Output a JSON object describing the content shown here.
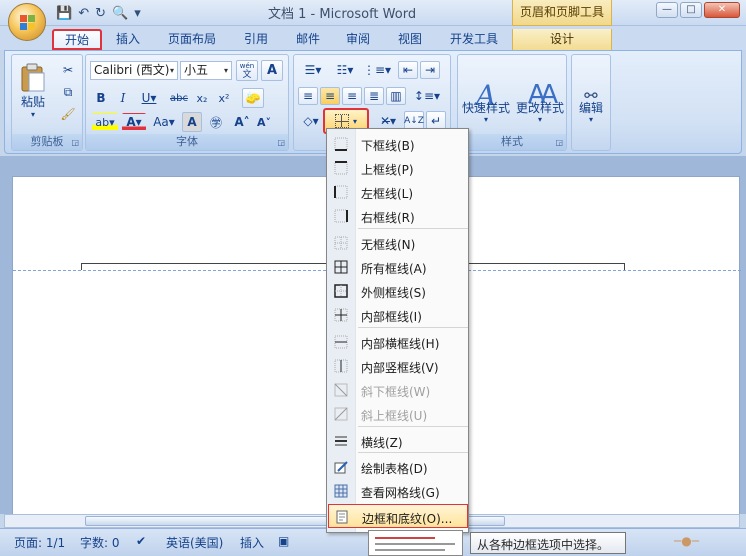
{
  "titlebar": {
    "doc_title": "文档 1 - Microsoft Word",
    "context_title": "页眉和页脚工具",
    "window_buttons": [
      "—",
      "□",
      "✕"
    ]
  },
  "tabs": [
    "开始",
    "插入",
    "页面布局",
    "引用",
    "邮件",
    "审阅",
    "视图",
    "开发工具",
    "设计"
  ],
  "active_tab": "开始",
  "ribbon": {
    "clipboard": {
      "paste": "粘贴",
      "label": "剪贴板"
    },
    "font": {
      "name": "Calibri (西文)",
      "size": "小五",
      "wen": "wén",
      "label": "字体"
    },
    "styles": {
      "quick": "快速样式",
      "change": "更改样式",
      "label": "样式"
    },
    "editing": {
      "label": "编辑"
    }
  },
  "menu": {
    "items": [
      {
        "label": "下框线(B)",
        "icon": "border-bottom-icon",
        "disabled": false
      },
      {
        "label": "上框线(P)",
        "icon": "border-top-icon",
        "disabled": false
      },
      {
        "label": "左框线(L)",
        "icon": "border-left-icon",
        "disabled": false
      },
      {
        "label": "右框线(R)",
        "icon": "border-right-icon",
        "disabled": false
      },
      {
        "label": "无框线(N)",
        "icon": "border-none-icon",
        "disabled": false
      },
      {
        "label": "所有框线(A)",
        "icon": "border-all-icon",
        "disabled": false
      },
      {
        "label": "外侧框线(S)",
        "icon": "border-outside-icon",
        "disabled": false
      },
      {
        "label": "内部框线(I)",
        "icon": "border-inside-icon",
        "disabled": false
      },
      {
        "label": "内部横框线(H)",
        "icon": "border-inside-horizontal-icon",
        "disabled": false
      },
      {
        "label": "内部竖框线(V)",
        "icon": "border-inside-vertical-icon",
        "disabled": false
      },
      {
        "label": "斜下框线(W)",
        "icon": "border-diagonal-down-icon",
        "disabled": true
      },
      {
        "label": "斜上框线(U)",
        "icon": "border-diagonal-up-icon",
        "disabled": true
      },
      {
        "label": "横线(Z)",
        "icon": "horizontal-line-icon",
        "disabled": false
      },
      {
        "label": "绘制表格(D)",
        "icon": "draw-table-icon",
        "disabled": false
      },
      {
        "label": "查看网格线(G)",
        "icon": "view-gridlines-icon",
        "disabled": false
      },
      {
        "label": "边框和底纹(O)...",
        "icon": "borders-shading-icon",
        "disabled": false
      }
    ],
    "highlighted": "边框和底纹(O)..."
  },
  "tooltip": "从各种边框选项中选择。",
  "statusbar": {
    "page": "页面: 1/1",
    "words": "字数: 0",
    "language": "英语(美国)",
    "mode": "插入"
  },
  "colors": {
    "accent_red": "#e0333b",
    "ribbon_blue": "#d2e1f4",
    "highlight_yellow": "#ffe39b"
  }
}
